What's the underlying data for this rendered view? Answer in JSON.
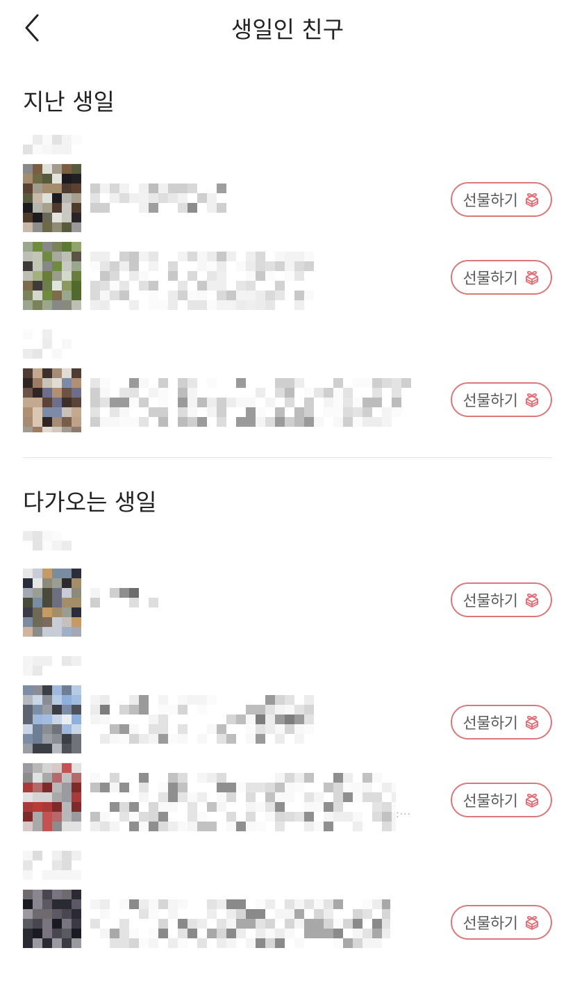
{
  "header": {
    "title": "생일인 친구",
    "back_icon": "chevron-left-icon"
  },
  "sections": [
    {
      "title": "지난 생일"
    },
    {
      "title": "다가오는 생일"
    }
  ],
  "gift_button": {
    "label": "선물하기",
    "icon": "gift-icon",
    "border_color": "#d9777a",
    "icon_color": "#e06b72"
  },
  "truncation_mark": ":···"
}
